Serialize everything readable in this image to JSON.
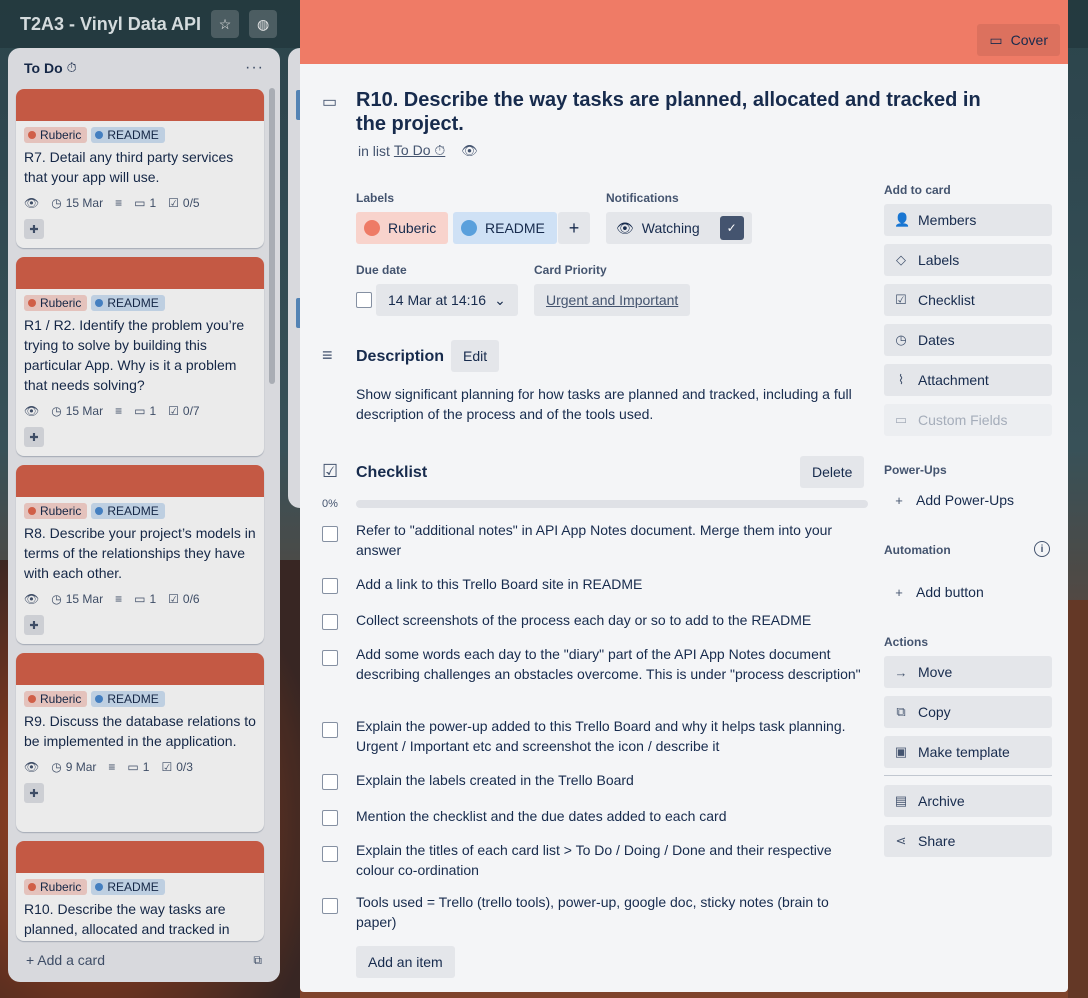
{
  "board": {
    "title": "T2A3 - Vinyl Data API",
    "star_icon": "star-icon",
    "visibility_icon": "globe-icon"
  },
  "list": {
    "title": "To Do",
    "title_emoji": "⏱",
    "menu": "···",
    "add_card": "+ Add a card",
    "cards": [
      {
        "labels": [
          "Ruberic",
          "README"
        ],
        "text": "R7. Detail any third party services that your app will use.",
        "due": "15 Mar",
        "comments": "1",
        "checklist": "0/5"
      },
      {
        "labels": [
          "Ruberic",
          "README"
        ],
        "text": "R1 / R2. Identify the problem you’re trying to solve by building this particular App. Why is it a problem that needs solving?",
        "due": "15 Mar",
        "comments": "1",
        "checklist": "0/7"
      },
      {
        "labels": [
          "Ruberic",
          "README"
        ],
        "text": "R8. Describe your project’s models in terms of the relationships they have with each other.",
        "due": "15 Mar",
        "comments": "1",
        "checklist": "0/6"
      },
      {
        "labels": [
          "Ruberic",
          "README"
        ],
        "text": "R9. Discuss the database relations to be implemented in the application.",
        "due": "9 Mar",
        "comments": "1",
        "checklist": "0/3"
      },
      {
        "labels": [
          "Ruberic",
          "README"
        ],
        "text": "R10. Describe the way tasks are planned, allocated and tracked in"
      }
    ]
  },
  "modal": {
    "cover_button": "Cover",
    "title": "R10. Describe the way tasks are planned, allocated and tracked in the project.",
    "in_list_prefix": "in list",
    "in_list_name": "To Do ⏱",
    "labels_heading": "Labels",
    "labels": [
      {
        "name": "Ruberic",
        "color": "#ee7b66"
      },
      {
        "name": "README",
        "color": "#5aa0dc"
      }
    ],
    "add_label": "+",
    "notifications_heading": "Notifications",
    "watching": "Watching",
    "watching_check": "✓",
    "due_heading": "Due date",
    "due_value": "14 Mar at 14:16",
    "priority_heading": "Card Priority",
    "priority_value": "Urgent and Important",
    "description_heading": "Description",
    "description_edit": "Edit",
    "description_text": "Show significant planning for how tasks are planned and tracked, including a full description of the process and of the tools used.",
    "checklist_heading": "Checklist",
    "checklist_delete": "Delete",
    "checklist_progress_text": "0%",
    "checklist_progress": 0,
    "checklist_items": [
      "Refer to \"additional notes\" in API App Notes document. Merge them into your answer",
      "Add a link to this Trello Board site in README",
      "Collect screenshots of the process each day or so to add to the README",
      "Add some words each day to the \"diary\" part of the API App Notes document describing challenges an obstacles overcome. This is under \"process description\"",
      "Explain the power-up added to this Trello Board and why it helps task planning. Urgent / Important etc and screenshot the icon / describe it",
      "Explain the labels created in the Trello Board",
      "Mention the checklist and the due dates added to each card",
      "Explain the titles of each card list > To Do / Doing / Done and their respective colour co-ordination",
      "Tools used = Trello (trello tools), power-up, google doc, sticky notes (brain to paper)"
    ],
    "add_item": "Add an item"
  },
  "sidebar": {
    "add_to_card_heading": "Add to card",
    "add_to_card": [
      {
        "label": "Members",
        "icon": "person-icon"
      },
      {
        "label": "Labels",
        "icon": "tag-icon"
      },
      {
        "label": "Checklist",
        "icon": "checkbox-icon"
      },
      {
        "label": "Dates",
        "icon": "clock-icon"
      },
      {
        "label": "Attachment",
        "icon": "paperclip-icon"
      },
      {
        "label": "Custom Fields",
        "icon": "fields-icon"
      }
    ],
    "powerups_heading": "Power-Ups",
    "add_powerups": "Add Power-Ups",
    "automation_heading": "Automation",
    "add_button": "Add button",
    "actions_heading": "Actions",
    "actions": [
      {
        "label": "Move",
        "icon": "arrow-right-icon"
      },
      {
        "label": "Copy",
        "icon": "copy-icon"
      },
      {
        "label": "Make template",
        "icon": "template-icon"
      },
      {
        "label": "Archive",
        "icon": "archive-icon"
      },
      {
        "label": "Share",
        "icon": "share-icon"
      }
    ]
  }
}
